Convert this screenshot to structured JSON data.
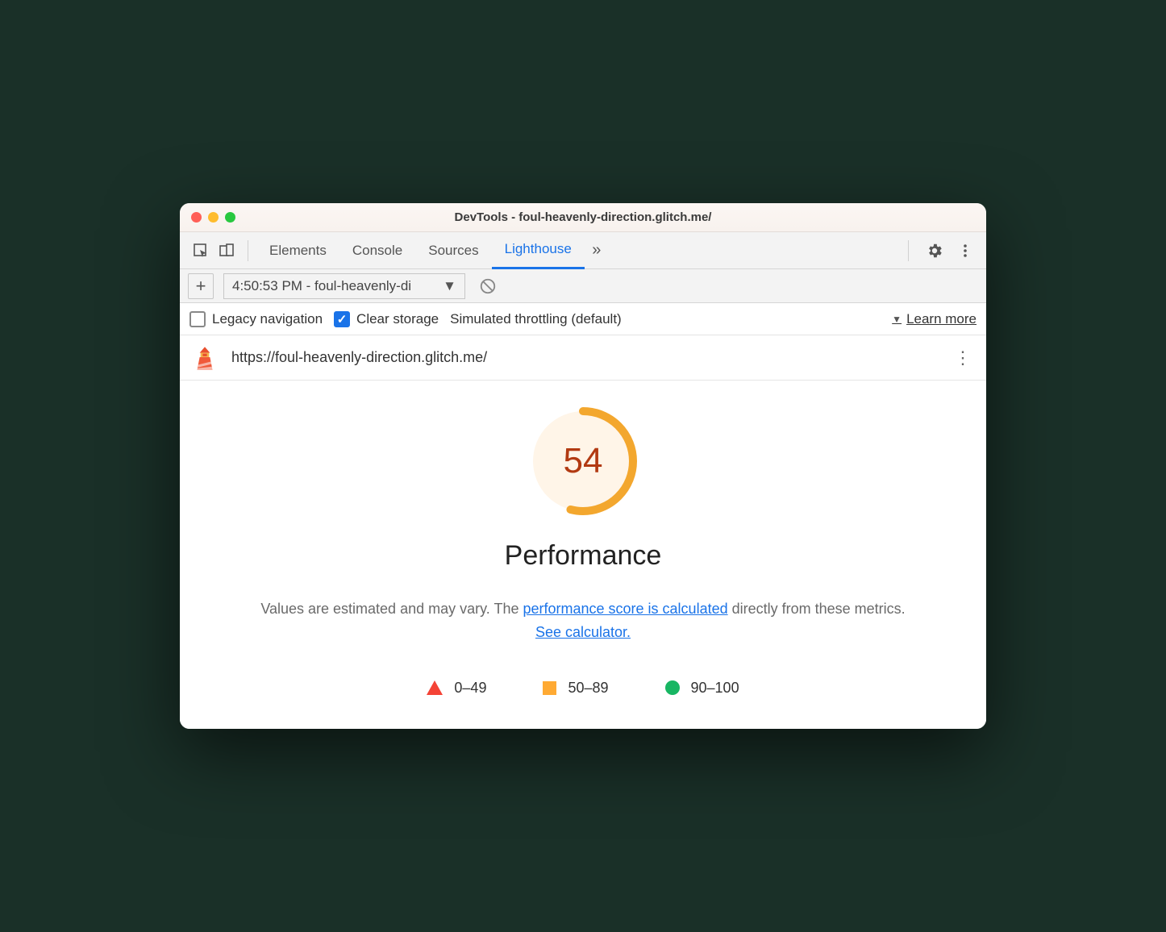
{
  "window": {
    "title": "DevTools - foul-heavenly-direction.glitch.me/"
  },
  "tabs": {
    "elements": "Elements",
    "console": "Console",
    "sources": "Sources",
    "lighthouse": "Lighthouse"
  },
  "subbar": {
    "selected_report": "4:50:53 PM - foul-heavenly-di"
  },
  "options": {
    "legacy_navigation": "Legacy navigation",
    "clear_storage": "Clear storage",
    "throttling": "Simulated throttling (default)",
    "learn_more": "Learn more"
  },
  "url": "https://foul-heavenly-direction.glitch.me/",
  "report": {
    "score": "54",
    "title": "Performance",
    "desc_prefix": "Values are estimated and may vary. The ",
    "link1": "performance score is calculated",
    "desc_mid": " directly from these metrics. ",
    "link2": "See calculator.",
    "legend": {
      "r1": "0–49",
      "r2": "50–89",
      "r3": "90–100"
    }
  },
  "chart_data": {
    "type": "pie",
    "title": "Performance",
    "categories": [
      "score",
      "remaining"
    ],
    "values": [
      54,
      46
    ],
    "ylim": [
      0,
      100
    ]
  }
}
